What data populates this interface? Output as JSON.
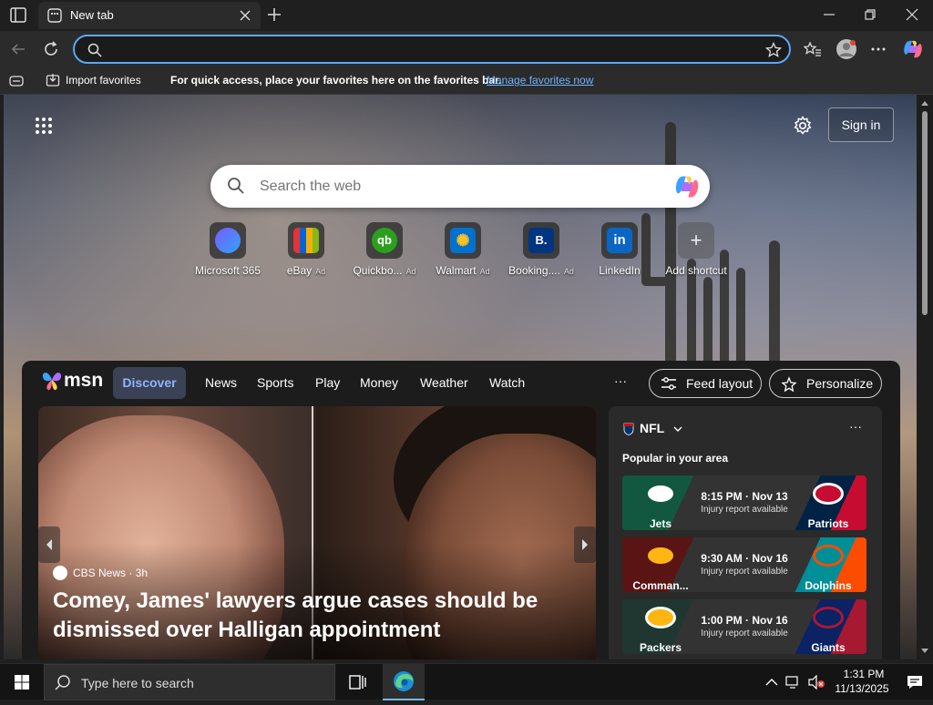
{
  "browser": {
    "tab_title": "New tab",
    "address_value": "",
    "favorites_bar": {
      "import_label": "Import favorites",
      "message": "For quick access, place your favorites here on the favorites bar.",
      "manage_link": "Manage favorites now"
    }
  },
  "ntp": {
    "signin_label": "Sign in",
    "search_placeholder": "Search the web",
    "shortcuts": [
      {
        "label": "Microsoft 365",
        "ad": "",
        "icon": "microsoft-365-icon"
      },
      {
        "label": "eBay",
        "ad": "Ad",
        "icon": "ebay-icon"
      },
      {
        "label": "Quickbo...",
        "ad": "Ad",
        "icon": "quickbooks-icon"
      },
      {
        "label": "Walmart",
        "ad": "Ad",
        "icon": "walmart-icon"
      },
      {
        "label": "Booking....",
        "ad": "Ad",
        "icon": "booking-icon"
      },
      {
        "label": "LinkedIn",
        "ad": "",
        "icon": "linkedin-icon"
      },
      {
        "label": "Add shortcut",
        "ad": "",
        "icon": "plus-icon"
      }
    ]
  },
  "feed": {
    "brand": "msn",
    "tabs": [
      "Discover",
      "News",
      "Sports",
      "Play",
      "Money",
      "Weather",
      "Watch"
    ],
    "more": "···",
    "feed_layout_label": "Feed layout",
    "personalize_label": "Personalize",
    "hero": {
      "source": "CBS News · 3h",
      "headline": "Comey, James' lawyers argue cases should be dismissed over Halligan appointment"
    },
    "sports": {
      "league": "NFL",
      "subtitle": "Popular in your area",
      "more": "···",
      "games": [
        {
          "home": "Jets",
          "away": "Patriots",
          "time": "8:15 PM · Nov 13",
          "note": "Injury report available"
        },
        {
          "home": "Comman...",
          "away": "Dolphins",
          "time": "9:30 AM · Nov 16",
          "note": "Injury report available"
        },
        {
          "home": "Packers",
          "away": "Giants",
          "time": "1:00 PM · Nov 16",
          "note": "Injury report available"
        }
      ]
    }
  },
  "taskbar": {
    "search_placeholder": "Type here to search",
    "time": "1:31 PM",
    "date": "11/13/2025"
  },
  "colors": {
    "accent": "#5aa9f5",
    "link": "#6cb4ff",
    "discover_text": "#8fb4ff"
  }
}
